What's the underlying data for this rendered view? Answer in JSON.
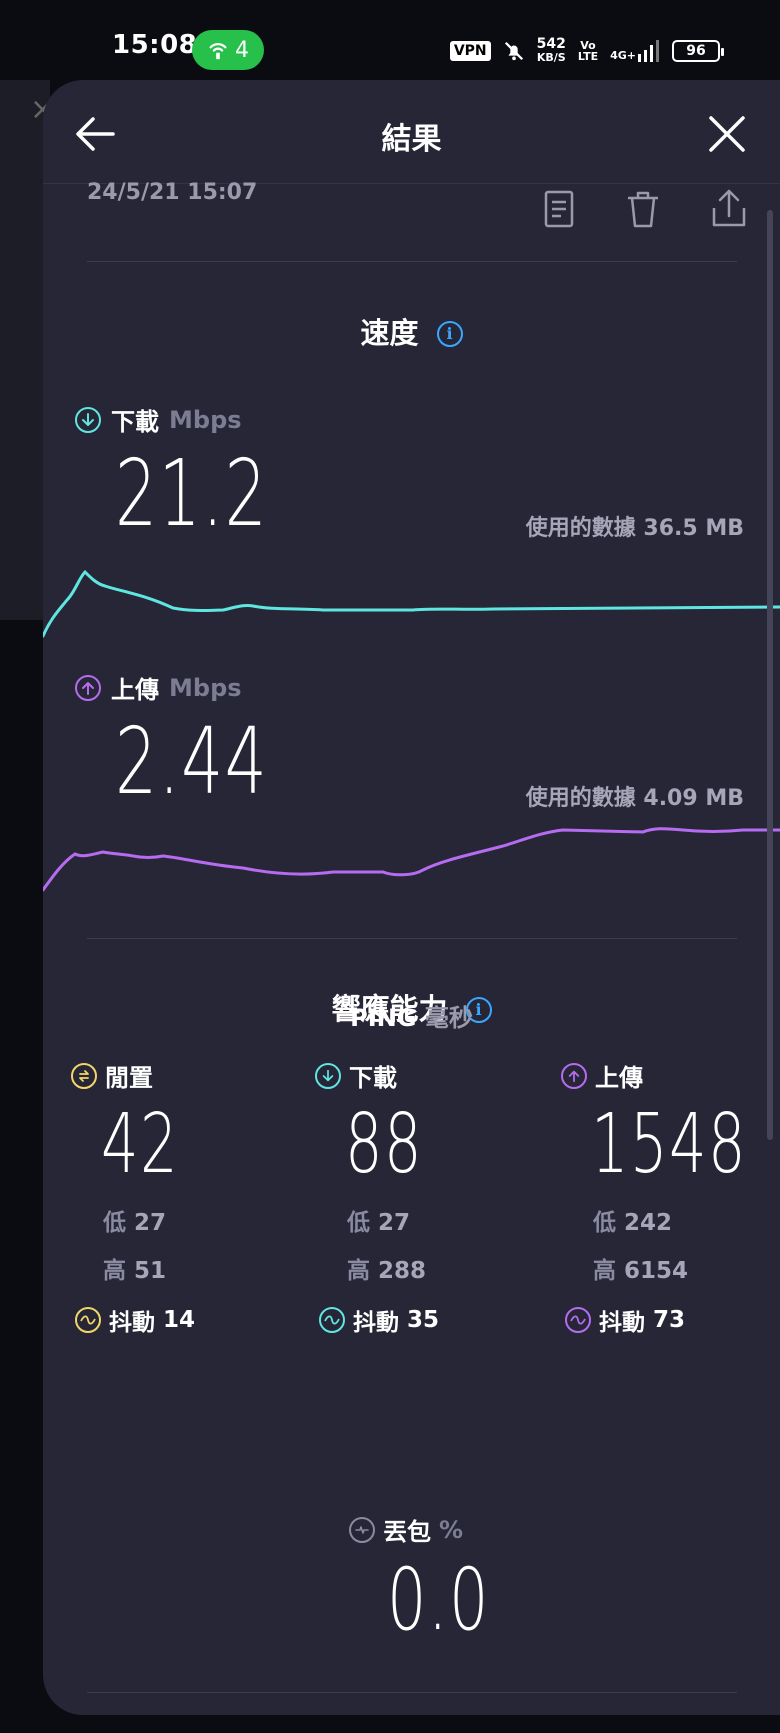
{
  "status_bar": {
    "time": "15:08",
    "hotspot_count": "4",
    "vpn": "VPN",
    "net_speed_value": "542",
    "net_speed_unit": "KB/S",
    "volte_top": "Vo",
    "volte_bottom": "LTE",
    "network": "4G+",
    "battery": "96"
  },
  "header": {
    "title": "結果"
  },
  "result": {
    "timestamp": "24/5/21 15:07"
  },
  "speed": {
    "section_title": "速度",
    "download": {
      "label": "下載",
      "unit": "Mbps",
      "value": "21.2",
      "data_used_label": "使用的數據",
      "data_used": "36.5 MB",
      "color": "#5fe6e0"
    },
    "upload": {
      "label": "上傳",
      "unit": "Mbps",
      "value": "2.44",
      "data_used_label": "使用的數據",
      "data_used": "4.09 MB",
      "color": "#b66cf0"
    }
  },
  "responsiveness": {
    "section_title": "響應能力",
    "ping_label": "PING",
    "ping_unit": "毫秒",
    "low_label": "低",
    "high_label": "高",
    "jitter_label": "抖動",
    "idle": {
      "label": "閒置",
      "value": "42",
      "low": "27",
      "high": "51",
      "jitter": "14",
      "color": "#f4d56a"
    },
    "download": {
      "label": "下載",
      "value": "88",
      "low": "27",
      "high": "288",
      "jitter": "35",
      "color": "#5fe6e0"
    },
    "upload": {
      "label": "上傳",
      "value": "1548",
      "low": "242",
      "high": "6154",
      "jitter": "73",
      "color": "#b66cf0"
    }
  },
  "packet_loss": {
    "label": "丟包",
    "unit": "%",
    "value": "0.0"
  }
}
